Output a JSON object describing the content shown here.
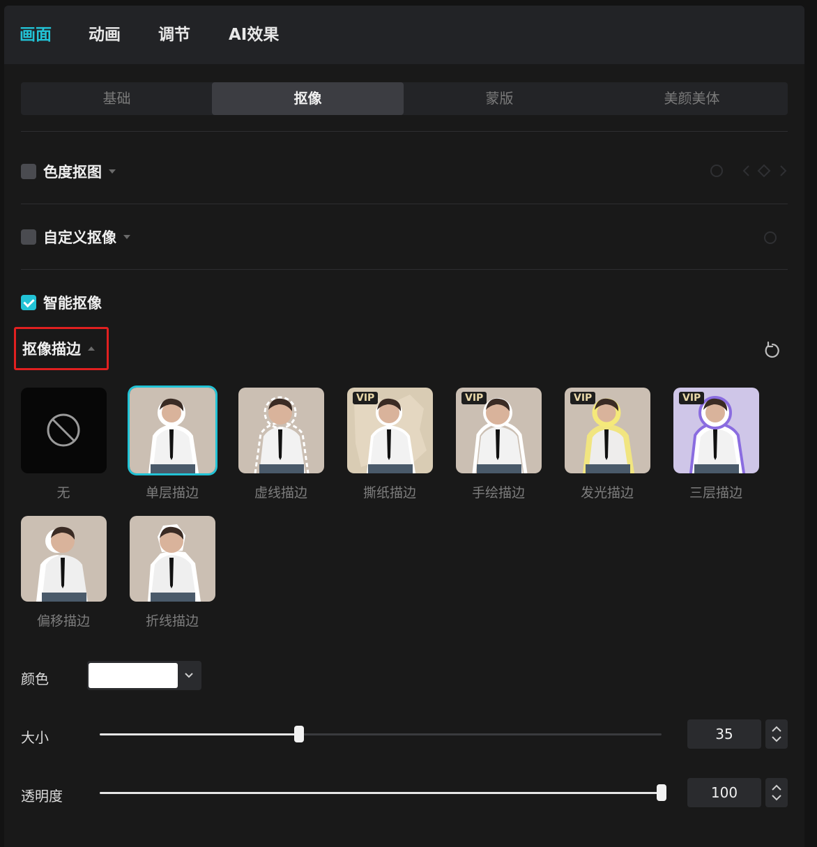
{
  "top_tabs": [
    {
      "label": "画面",
      "active": true
    },
    {
      "label": "动画",
      "active": false
    },
    {
      "label": "调节",
      "active": false
    },
    {
      "label": "AI效果",
      "active": false
    }
  ],
  "sub_tabs": [
    {
      "label": "基础",
      "active": false
    },
    {
      "label": "抠像",
      "active": true
    },
    {
      "label": "蒙版",
      "active": false
    },
    {
      "label": "美颜美体",
      "active": false
    }
  ],
  "sections": {
    "chroma_key": {
      "label": "色度抠图",
      "checked": false
    },
    "custom_cutout": {
      "label": "自定义抠像",
      "checked": false
    },
    "smart_cutout": {
      "label": "智能抠像",
      "checked": true
    }
  },
  "stroke": {
    "header_label": "抠像描边",
    "options": [
      {
        "label": "无",
        "vip": false,
        "selected": false
      },
      {
        "label": "单层描边",
        "vip": false,
        "selected": true
      },
      {
        "label": "虚线描边",
        "vip": false,
        "selected": false
      },
      {
        "label": "撕纸描边",
        "vip": true,
        "selected": false
      },
      {
        "label": "手绘描边",
        "vip": true,
        "selected": false
      },
      {
        "label": "发光描边",
        "vip": true,
        "selected": false
      },
      {
        "label": "三层描边",
        "vip": true,
        "selected": false
      },
      {
        "label": "偏移描边",
        "vip": false,
        "selected": false
      },
      {
        "label": "折线描边",
        "vip": false,
        "selected": false
      }
    ],
    "vip_badge": "VIP"
  },
  "properties": {
    "color": {
      "label": "颜色",
      "value": "#ffffff"
    },
    "size": {
      "label": "大小",
      "value": "35",
      "fraction": 0.355
    },
    "opacity": {
      "label": "透明度",
      "value": "100",
      "fraction": 1.0
    }
  },
  "colors": {
    "accent": "#22c3d6",
    "highlight_border": "#e02020"
  }
}
